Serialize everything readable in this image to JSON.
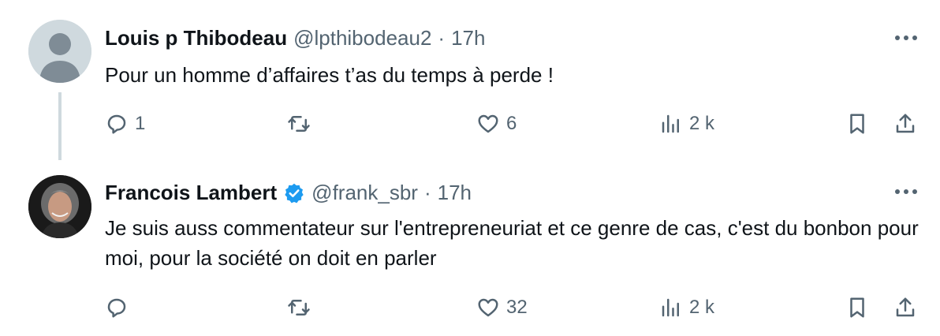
{
  "tweets": [
    {
      "name": "Louis p Thibodeau",
      "handle": "@lpthibodeau2",
      "separator": "·",
      "time": "17h",
      "text": "Pour un homme d’affaires t’as du temps à perde !",
      "verified": false,
      "replies": "1",
      "retweets": "",
      "likes": "6",
      "views": "2 k"
    },
    {
      "name": "Francois Lambert",
      "handle": "@frank_sbr",
      "separator": "·",
      "time": "17h",
      "text": "Je suis auss commentateur sur l'entrepreneuriat et ce genre de cas, c'est du bonbon pour moi, pour la société on doit en parler",
      "verified": true,
      "replies": "",
      "retweets": "",
      "likes": "32",
      "views": "2 k"
    }
  ],
  "colors": {
    "text": "#0f1419",
    "secondary": "#536471",
    "verified": "#1d9bf0",
    "thread_line": "#cfd9de"
  },
  "icons": [
    "reply-icon",
    "retweet-icon",
    "like-icon",
    "views-icon",
    "bookmark-icon",
    "share-icon",
    "more-icon",
    "verified-badge-icon"
  ]
}
